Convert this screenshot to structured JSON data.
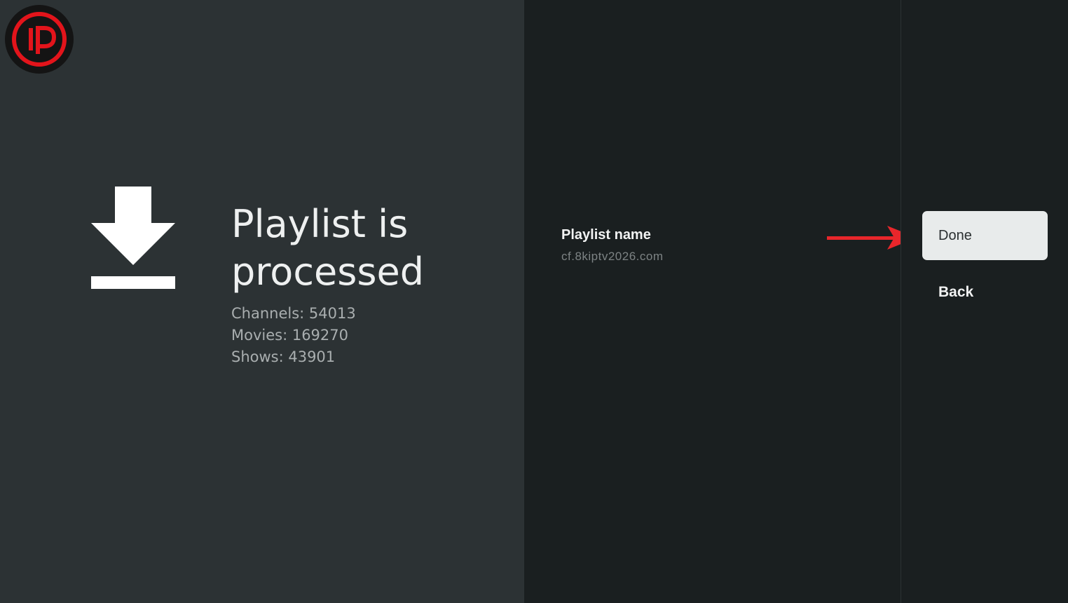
{
  "status": {
    "title_line1": "Playlist is",
    "title_line2": "processed",
    "channels": "Channels: 54013",
    "movies": "Movies: 169270",
    "shows": "Shows: 43901"
  },
  "playlist": {
    "label": "Playlist name",
    "value": "cf.8kiptv2026.com"
  },
  "actions": {
    "done_label": "Done",
    "back_label": "Back"
  },
  "icons": {
    "logo": "ip-logo-icon",
    "status": "download-icon",
    "annotation": "arrow-right-icon"
  },
  "colors": {
    "logo_red": "#e3141b",
    "annotation_red": "#e8262b",
    "button_bg": "#e8ebeb"
  }
}
